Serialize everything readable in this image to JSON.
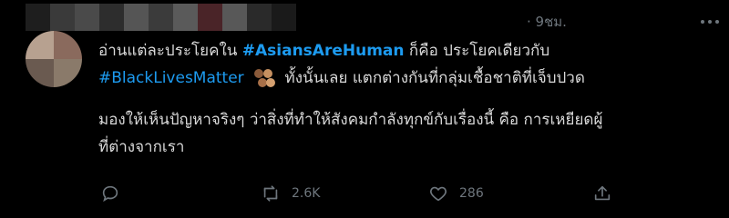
{
  "tweet": {
    "timestamp": "· 9ชม.",
    "more_icon": "ellipsis-icon",
    "body": {
      "line1_text": "อ่านแต่ละประโยคใน ",
      "line1_hashtag": "#AsiansAreHuman",
      "line1_rest": " ก็คือ ประโยคเดียวกับ",
      "line2_hashtag": "#BlackLivesMatter",
      "line2_emoji": "raised-fists-emoji",
      "line2_rest": " ทั้งนั้นเลย แตกต่างกันที่กลุ่มเชื้อชาติที่เจ็บปวด",
      "para2_line1": "มองให้เห็นปัญหาจริงๆ ว่าสิ่งที่ทำให้สังคมกำลังทุกข์กับเรื่องนี้ คือ การเหยียดผู้",
      "para2_line2": "ที่ต่างจากเรา"
    },
    "actions": {
      "reply": {
        "icon": "reply-icon"
      },
      "retweet": {
        "icon": "retweet-icon",
        "count": "2.6K"
      },
      "like": {
        "icon": "heart-icon",
        "count": "286"
      },
      "share": {
        "icon": "share-icon"
      }
    },
    "colors": {
      "background": "#000000",
      "text": "#d9d9d9",
      "link": "#1d9bf0",
      "muted": "#6e767d"
    }
  }
}
